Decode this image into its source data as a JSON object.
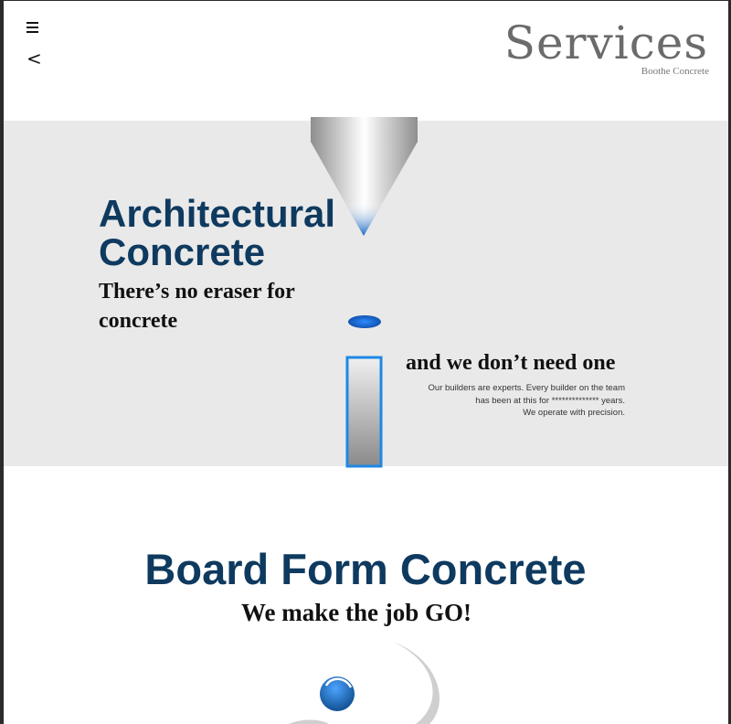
{
  "header": {
    "title": "Services",
    "subtitle": "Boothe Concrete",
    "menu_icon": "hamburger-menu-icon",
    "back_icon": "back-chevron-icon",
    "back_glyph": "<"
  },
  "hero": {
    "title_line1": "Architectural",
    "title_line2": "Concrete",
    "tagline": "There’s no eraser for concrete",
    "side_heading": "and we don’t need one",
    "body_lines": [
      "Our builders are experts.  Every builder on the team",
      "has been at this for  ************** years.",
      "We operate with precision."
    ],
    "background_color": "#e9e9e9"
  },
  "section": {
    "title": "Board Form Concrete",
    "tagline": "We make the job GO!"
  },
  "colors": {
    "accent_blue": "#0f3a5f",
    "bright_blue": "#1e88e5",
    "gray_text": "#6b6b6b"
  }
}
